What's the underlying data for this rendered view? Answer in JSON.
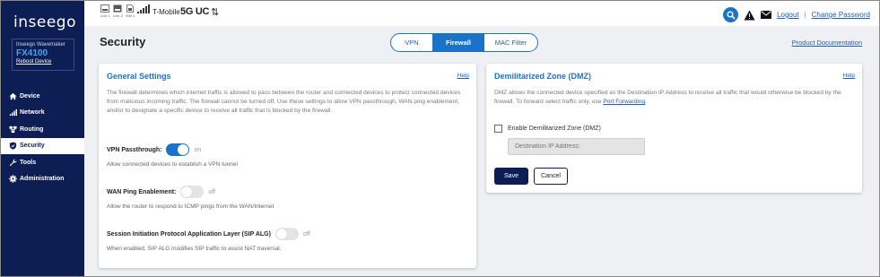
{
  "sidebar": {
    "logo": "inseego",
    "device": {
      "brand": "Inseego Wavemaker",
      "model": "FX4100",
      "reboot_label": "Reboot Device"
    },
    "items": [
      {
        "label": "Device",
        "icon": "home-icon"
      },
      {
        "label": "Network",
        "icon": "signal-bars-icon"
      },
      {
        "label": "Routing",
        "icon": "routing-icon"
      },
      {
        "label": "Security",
        "icon": "shield-icon",
        "active": true
      },
      {
        "label": "Tools",
        "icon": "wrench-icon"
      },
      {
        "label": "Administration",
        "icon": "gear-icon"
      }
    ]
  },
  "topbar": {
    "status_captions": [
      "Line 1",
      "Line 2",
      "SIM 1"
    ],
    "carrier": "T-Mobile",
    "network_type": "5G UC",
    "logout_label": "Logout",
    "separator": "|",
    "change_password_label": "Change Password"
  },
  "page": {
    "title": "Security",
    "tabs": [
      {
        "label": "VPN"
      },
      {
        "label": "Firewall",
        "active": true
      },
      {
        "label": "MAC Filter"
      }
    ],
    "product_doc_label": "Product Documentation"
  },
  "general": {
    "title": "General Settings",
    "help_label": "Help",
    "description": "The firewall determines which internet traffic is allowed to pass between the router and connected devices to protect connected devices from malicious incoming traffic. The firewall cannot be turned off. Use these settings to allow VPN passthrough, WAN ping enablement, and/or to designate a specific device to receive all traffic that is blocked by the firewall.",
    "settings": [
      {
        "label": "VPN Passthrough:",
        "state": "on",
        "note": "Allow connected devices to establish a VPN tunnel"
      },
      {
        "label": "WAN Ping Enablement:",
        "state": "off",
        "note": "Allow the router to respond to ICMP pings from the WAN/Internet"
      },
      {
        "label": "Session Initiation Protocol Application Layer (SIP ALG)",
        "state": "off",
        "note": "When enabled, SIP ALG modifies SIP traffic to assist NAT traversal."
      }
    ]
  },
  "dmz": {
    "title": "Demilitarized Zone (DMZ)",
    "help_label": "Help",
    "description": "DMZ allows the connected device specified as the Destination IP Address to receive all traffic that would otherwise be blocked by the firewall. To forward select traffic only, use",
    "link_label": "Port Forwarding",
    "period": ".",
    "checkbox_label": "Enable Demilitarized Zone (DMZ)",
    "checkbox_checked": false,
    "ip_placeholder": "Destination IP Address:",
    "save_label": "Save",
    "cancel_label": "Cancel"
  },
  "colors": {
    "sidebar": "#0c1e53",
    "accent": "#1b73c9",
    "background": "#eef0f4"
  }
}
